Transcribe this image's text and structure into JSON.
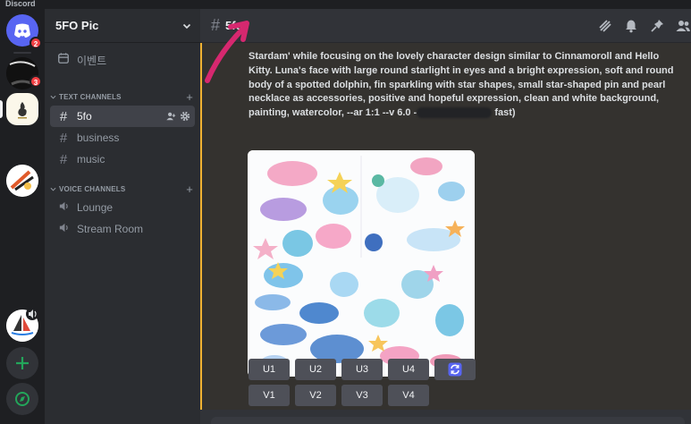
{
  "window": {
    "title": "Discord"
  },
  "rail": {
    "badges": [
      "2",
      "3"
    ]
  },
  "server": {
    "name": "5FO Pic"
  },
  "sidebar": {
    "events_label": "이벤트",
    "text_category": "TEXT CHANNELS",
    "voice_category": "VOICE CHANNELS",
    "text_channels": [
      {
        "label": "5fo",
        "active": true
      },
      {
        "label": "business"
      },
      {
        "label": "music"
      }
    ],
    "voice_channels": [
      {
        "label": "Lounge"
      },
      {
        "label": "Stream Room"
      }
    ]
  },
  "header": {
    "channel": "5fo"
  },
  "message": {
    "line1": "Stardam' while focusing on the lovely character design similar to Cinnamoroll and Hello",
    "line2": "Kitty. Luna's face with large round starlight in eyes and a bright expression, soft and round",
    "line3": "body of a spotted dolphin, fin sparkling with star shapes, small star-shaped pin and pearl",
    "line4": "necklace as accessories, positive and hopeful expression, clean and white background,",
    "line5_a": "painting, watercolor, --ar 1:1 --v 6.0 -",
    "line5_b": "fast)"
  },
  "buttons": {
    "upscale": [
      "U1",
      "U2",
      "U3",
      "U4"
    ],
    "variation": [
      "V1",
      "V2",
      "V3",
      "V4"
    ],
    "reroll_icon": "refresh-icon"
  },
  "colors": {
    "accent_gold": "#f0b232",
    "arrow_pink": "#d6286f",
    "reroll_blue": "#5865f2"
  }
}
